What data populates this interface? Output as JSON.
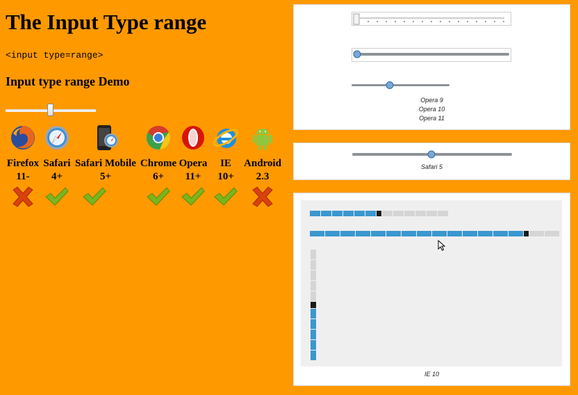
{
  "page": {
    "title": "The Input Type range",
    "code": "<input type=range>",
    "subtitle": "Input type range Demo",
    "demo_slider_value": 0.5
  },
  "browsers": [
    {
      "name": "Firefox",
      "version": "11-",
      "supported": false,
      "icon": "firefox-icon"
    },
    {
      "name": "Safari",
      "version": "4+",
      "supported": true,
      "icon": "safari-icon"
    },
    {
      "name": "Safari Mobile",
      "version": "5+",
      "supported": true,
      "icon": "safari-mobile-icon"
    },
    {
      "name": "Chrome",
      "version": "6+",
      "supported": true,
      "icon": "chrome-icon"
    },
    {
      "name": "Opera",
      "version": "11+",
      "supported": true,
      "icon": "opera-icon"
    },
    {
      "name": "IE",
      "version": "10+",
      "supported": true,
      "icon": "ie-icon"
    },
    {
      "name": "Android",
      "version": "2.3",
      "supported": false,
      "icon": "android-icon"
    }
  ],
  "panels": {
    "opera": {
      "captions": [
        "Opera 9",
        "Opera 10",
        "Opera 11"
      ]
    },
    "safari": {
      "caption": "Safari 5"
    },
    "ie": {
      "caption": "IE 10"
    }
  },
  "colors": {
    "background": "#FF9900",
    "ie_fill": "#3A97CF",
    "ie_empty": "#D5D5D5",
    "ie_thumb": "#1A1A1A"
  }
}
